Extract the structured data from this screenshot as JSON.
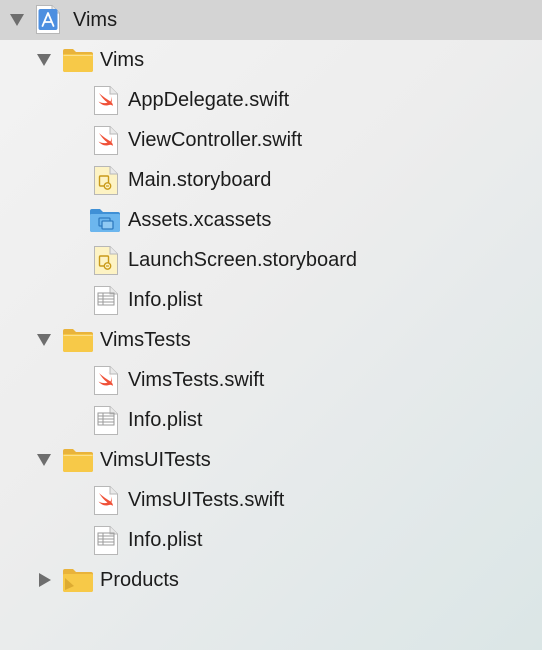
{
  "navigator": {
    "project": {
      "label": "Vims",
      "icon": "xcode-project-icon",
      "expanded": true
    },
    "groups": [
      {
        "label": "Vims",
        "icon": "folder-icon",
        "expanded": true,
        "files": [
          {
            "label": "AppDelegate.swift",
            "icon": "swift-file-icon",
            "badge": "SWIFT"
          },
          {
            "label": "ViewController.swift",
            "icon": "swift-file-icon",
            "badge": "SWIFT"
          },
          {
            "label": "Main.storyboard",
            "icon": "storyboard-file-icon"
          },
          {
            "label": "Assets.xcassets",
            "icon": "asset-catalog-icon"
          },
          {
            "label": "LaunchScreen.storyboard",
            "icon": "storyboard-file-icon"
          },
          {
            "label": "Info.plist",
            "icon": "plist-file-icon",
            "badge": "PLIST"
          }
        ]
      },
      {
        "label": "VimsTests",
        "icon": "folder-icon",
        "expanded": true,
        "files": [
          {
            "label": "VimsTests.swift",
            "icon": "swift-file-icon",
            "badge": "SWIFT"
          },
          {
            "label": "Info.plist",
            "icon": "plist-file-icon",
            "badge": "PLIST"
          }
        ]
      },
      {
        "label": "VimsUITests",
        "icon": "folder-icon",
        "expanded": true,
        "files": [
          {
            "label": "VimsUITests.swift",
            "icon": "swift-file-icon",
            "badge": "SWIFT"
          },
          {
            "label": "Info.plist",
            "icon": "plist-file-icon",
            "badge": "PLIST"
          }
        ]
      },
      {
        "label": "Products",
        "icon": "products-folder-icon",
        "expanded": false,
        "files": []
      }
    ]
  },
  "colors": {
    "selection": "#d4d4d4",
    "swift_orange": "#f05138",
    "folder_yellow": "#f7c948",
    "asset_blue": "#5aa9e6",
    "disclosure_gray": "#6e6e6e"
  }
}
